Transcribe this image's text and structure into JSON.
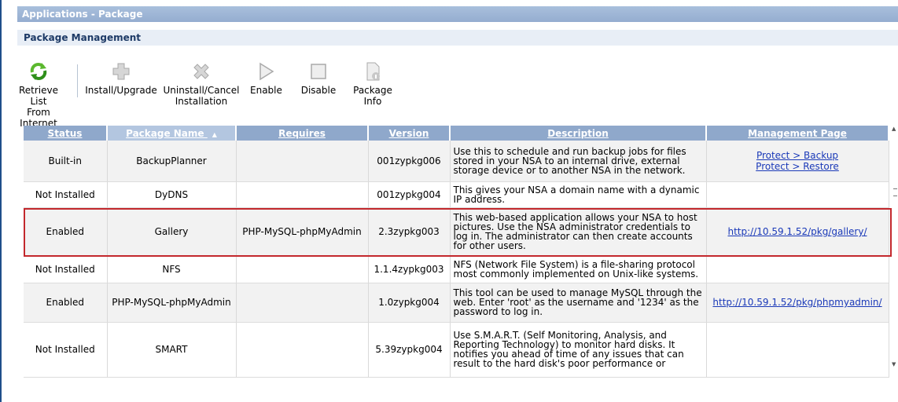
{
  "window": {
    "title": "Applications - Package",
    "section": "Package Management"
  },
  "toolbar": {
    "retrieve": "Retrieve\nList From\nInternet",
    "install": "Install/Upgrade",
    "uninstall": "Uninstall/Cancel\nInstallation",
    "enable": "Enable",
    "disable": "Disable",
    "info": "Package\nInfo"
  },
  "table": {
    "headers": {
      "status": "Status",
      "name": "Package Name",
      "requires": "Requires",
      "version": "Version",
      "description": "Description",
      "page": "Management Page"
    },
    "rows": [
      {
        "status": "Built-in",
        "name": "BackupPlanner",
        "requires": "",
        "version": "001zypkg006",
        "description": "Use this to schedule and run backup jobs for files stored in your NSA to an internal drive, external storage device or to another NSA in the network.",
        "link1": "Protect > Backup",
        "link2": "Protect > Restore"
      },
      {
        "status": "Not Installed",
        "name": "DyDNS",
        "requires": "",
        "version": "001zypkg004",
        "description": "This gives your NSA a domain name with a dynamic IP address.",
        "link1": "",
        "link2": ""
      },
      {
        "status": "Enabled",
        "name": "Gallery",
        "requires": "PHP-MySQL-phpMyAdmin",
        "version": "2.3zypkg003",
        "description": "This web-based application allows your NSA to host pictures. Use the NSA administrator credentials to log in. The administrator can then create accounts for other users.",
        "link1": "http://10.59.1.52/pkg/gallery/",
        "link2": ""
      },
      {
        "status": "Not Installed",
        "name": "NFS",
        "requires": "",
        "version": "1.1.4zypkg003",
        "description": "NFS (Network File System) is a file-sharing protocol most commonly implemented on Unix-like systems.",
        "link1": "",
        "link2": ""
      },
      {
        "status": "Enabled",
        "name": "PHP-MySQL-phpMyAdmin",
        "requires": "",
        "version": "1.0zypkg004",
        "description": "This tool can be used to manage MySQL through the web. Enter 'root' as the username and '1234' as the password to log in.",
        "link1": "http://10.59.1.52/pkg/phpmyadmin/",
        "link2": ""
      },
      {
        "status": "Not Installed",
        "name": "SMART",
        "requires": "",
        "version": "5.39zypkg004",
        "description": "Use S.M.A.R.T. (Self Monitoring, Analysis, and Reporting Technology) to monitor hard disks. It notifies you ahead of time of any issues that can result to the hard disk's poor performance or",
        "link1": "",
        "link2": ""
      }
    ]
  },
  "colors": {
    "header_bg": "#8fa8cb",
    "title_bg": "#95add0",
    "highlight": "#c3282d",
    "link": "#1a39b8"
  }
}
